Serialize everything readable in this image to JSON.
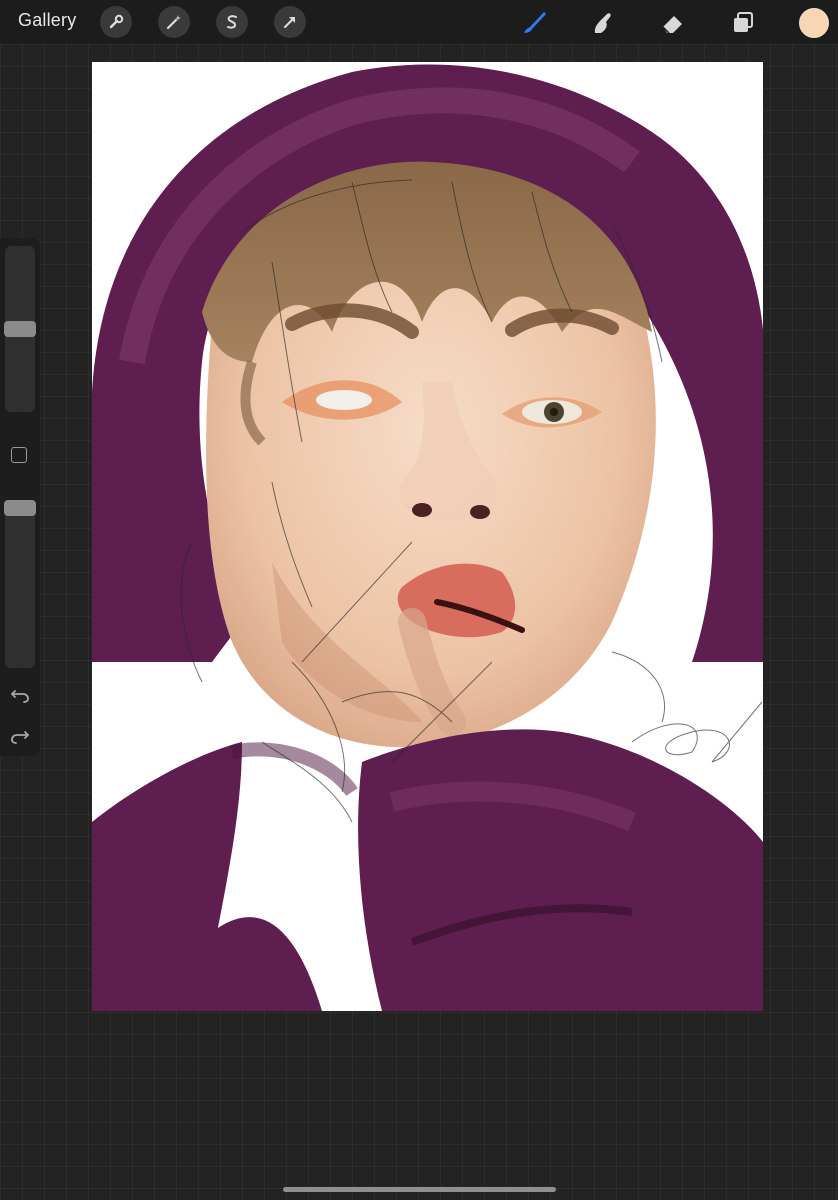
{
  "topbar": {
    "gallery_label": "Gallery",
    "left_tools": [
      {
        "name": "actions",
        "icon": "wrench-icon"
      },
      {
        "name": "adjustments",
        "icon": "magic-wand-icon"
      },
      {
        "name": "selection",
        "icon": "selection-s-icon"
      },
      {
        "name": "transform",
        "icon": "arrow-cursor-icon"
      }
    ],
    "right_tools": [
      {
        "name": "brush",
        "icon": "brush-icon",
        "active": true
      },
      {
        "name": "smudge",
        "icon": "smudge-finger-icon",
        "active": false
      },
      {
        "name": "eraser",
        "icon": "eraser-icon",
        "active": false
      },
      {
        "name": "layers",
        "icon": "layers-icon",
        "active": false
      }
    ],
    "current_color": "#f8d6b4",
    "active_tool_color": "#2f7cf6"
  },
  "sidebar": {
    "brush_size_level": 0.55,
    "opacity_level": 0.95,
    "icons": [
      "modify-square-icon",
      "undo-icon",
      "redo-icon"
    ]
  },
  "canvas": {
    "background": "#ffffff",
    "colors": {
      "hood": "#5e1e4f",
      "skin": "#efcbb0",
      "hair": "#9a7450",
      "lips": "#d86d5e"
    }
  }
}
